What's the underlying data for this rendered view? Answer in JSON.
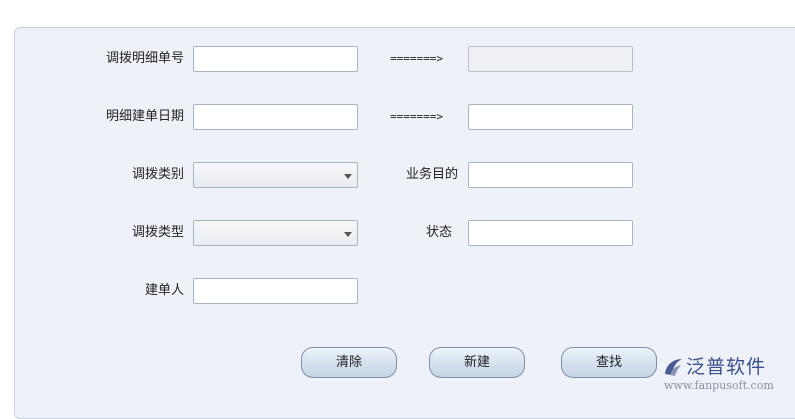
{
  "form": {
    "transfer_detail_no_label": "调拨明细单号",
    "arrow_1": "=======>",
    "detail_date_label": "明细建单日期",
    "arrow_2": "=======>",
    "transfer_category_label": "调拨类别",
    "business_purpose_label": "业务目的",
    "transfer_type_label": "调拨类型",
    "status_label": "状态",
    "creator_label": "建单人",
    "transfer_detail_no_from": "",
    "transfer_detail_no_to": "",
    "detail_date_from": "",
    "detail_date_to": "",
    "transfer_category_value": "",
    "business_purpose_value": "",
    "transfer_type_value": "",
    "status_value": "",
    "creator_value": ""
  },
  "buttons": {
    "clear_label": "清除",
    "new_label": "新建",
    "search_label": "查找"
  },
  "logo": {
    "name": "泛普软件",
    "url": "www.fanpusoft.com"
  },
  "colors": {
    "panel_bg": "#eef2f8",
    "button_bg": "#d2deec",
    "logo_text": "#3a4f8c"
  }
}
